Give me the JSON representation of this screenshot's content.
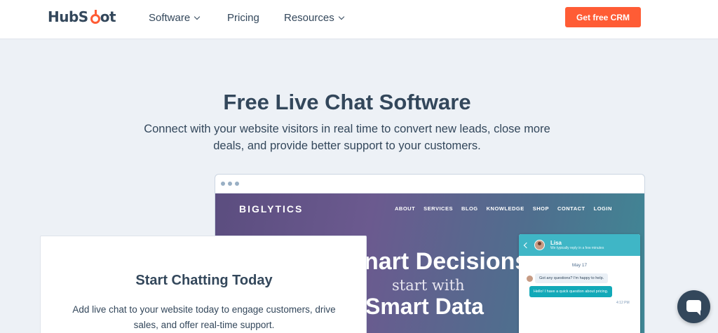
{
  "header": {
    "logo_text_left": "HubS",
    "logo_text_right": "ot",
    "nav": [
      {
        "label": "Software",
        "dropdown": true
      },
      {
        "label": "Pricing",
        "dropdown": false
      },
      {
        "label": "Resources",
        "dropdown": true
      }
    ],
    "cta_label": "Get free CRM"
  },
  "hero": {
    "title": "Free Live Chat Software",
    "subtitle": "Connect with your website visitors in real time to convert new leads, close more deals, and provide better support to your customers."
  },
  "mockup": {
    "site_logo": "BIGLYTICS",
    "site_nav": [
      "ABOUT",
      "SERVICES",
      "BLOG",
      "KNOWLEDGE",
      "SHOP",
      "CONTACT",
      "LOGIN"
    ],
    "headline_1": "nart Decisions",
    "headline_2": "start with",
    "headline_3": "Smart Data"
  },
  "chat_widget": {
    "agent_name": "Lisa",
    "agent_status": "We typically reply in a few minutes",
    "date": "May 17",
    "message_in": "Got any questions? I'm happy to help.",
    "message_out": "Hello! I have a quick question about pricing.",
    "time": "4:12 PM"
  },
  "card": {
    "title": "Start Chatting Today",
    "text": "Add live chat to your website today to engage customers, drive sales, and offer real-time support."
  },
  "colors": {
    "brand_orange": "#ff5c35",
    "text_dark": "#33475b",
    "chat_teal": "#3fb6c6",
    "page_bg": "#edf1f6"
  }
}
